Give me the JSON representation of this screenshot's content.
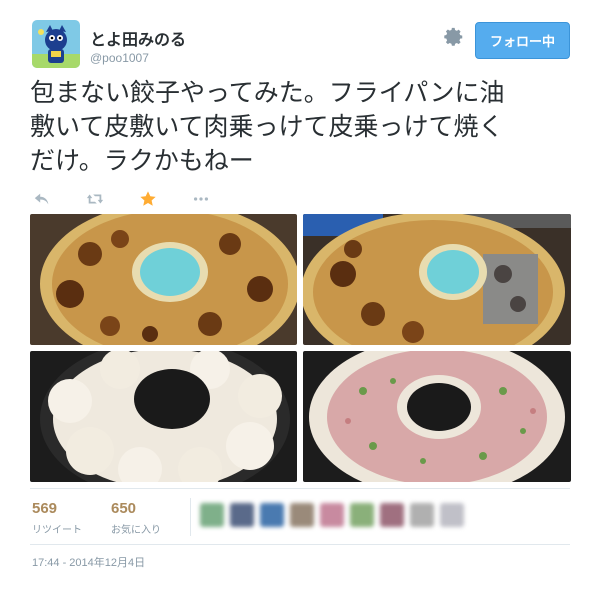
{
  "user": {
    "name": "とよ田みのる",
    "handle": "@poo1007"
  },
  "follow_button": {
    "label": "フォロー中"
  },
  "tweet": {
    "lines": [
      "包まない餃子やってみた。フライパンに油",
      "敷いて皮敷いて肉乗っけて皮乗っけて焼く",
      "だけ。ラクかもねー"
    ]
  },
  "actions": {
    "reply_icon": "reply-icon",
    "retweet_icon": "retweet-icon",
    "favorite_icon": "star-icon",
    "more_icon": "more-icon",
    "favorite_color": "#ffac33"
  },
  "photos": [
    {
      "name": "browned-gyoza-ring"
    },
    {
      "name": "browned-gyoza-ring-flipped"
    },
    {
      "name": "raw-wrappers-in-pan"
    },
    {
      "name": "meat-filling-on-wrappers"
    }
  ],
  "stats": {
    "retweets": {
      "count": "569",
      "label": "リツイート"
    },
    "favorites": {
      "count": "650",
      "label": "お気に入り"
    }
  },
  "timestamp": "17:44 - 2014年12月4日",
  "colors": {
    "accent": "#55acee",
    "text": "#292f33",
    "muted": "#8899a6"
  }
}
